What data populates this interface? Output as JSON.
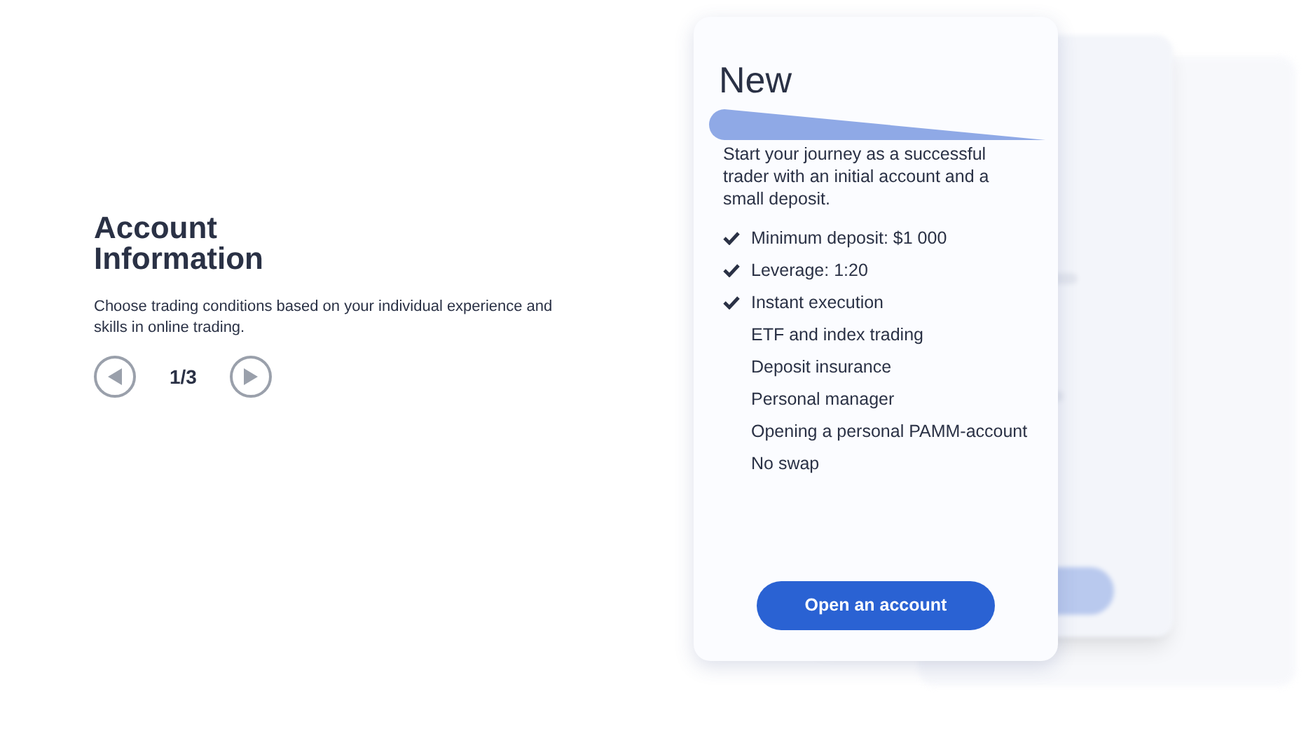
{
  "intro": {
    "title": "Account Information",
    "description": "Choose trading conditions based on your individual experience and skills in online trading.",
    "pager": "1/3"
  },
  "card": {
    "title": "New",
    "description": "Start your journey as a successful trader with an initial account and a small deposit.",
    "features": [
      {
        "label": "Minimum deposit: $1 000",
        "included": true
      },
      {
        "label": "Leverage: 1:20",
        "included": true
      },
      {
        "label": "Instant execution",
        "included": true
      },
      {
        "label": "ETF and index trading",
        "included": false
      },
      {
        "label": "Deposit insurance",
        "included": false
      },
      {
        "label": "Personal manager",
        "included": false
      },
      {
        "label": "Opening a personal PAMM-account",
        "included": false
      },
      {
        "label": "No swap",
        "included": false
      }
    ],
    "button": "Open an account"
  }
}
